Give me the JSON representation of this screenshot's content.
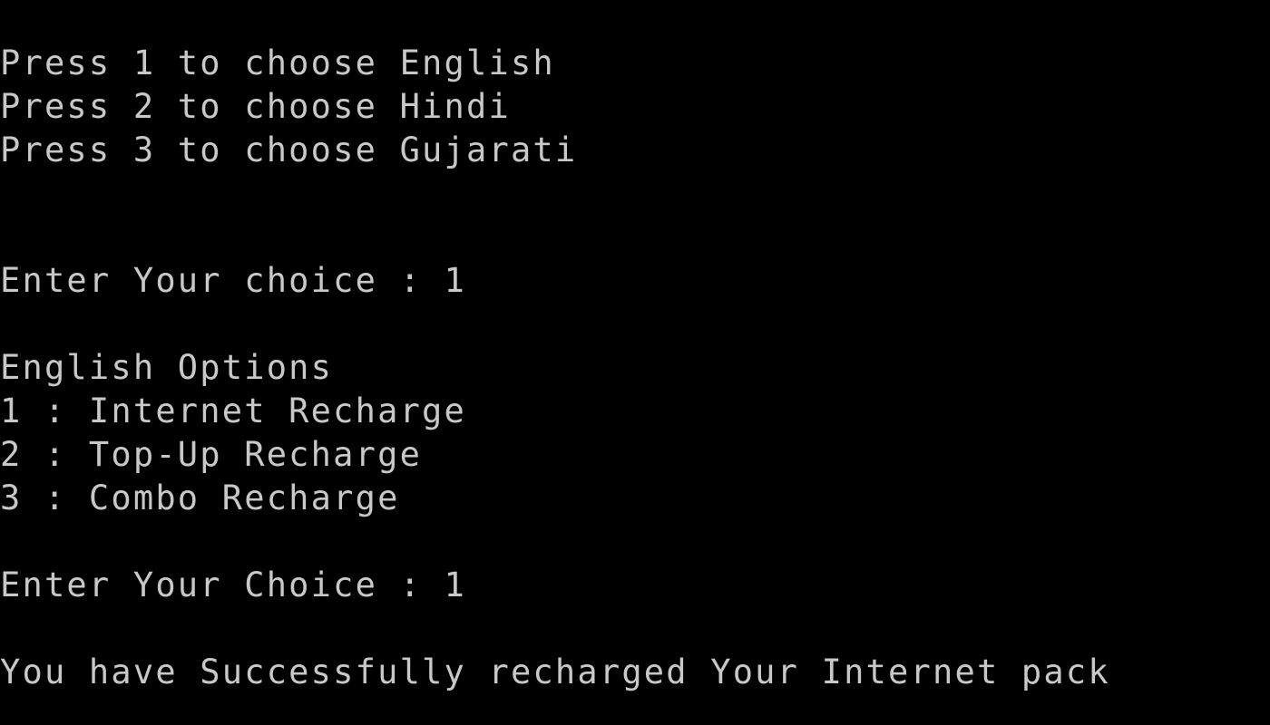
{
  "console": {
    "language_menu": [
      "Press 1 to choose English",
      "Press 2 to choose Hindi",
      "Press 3 to choose Gujarati"
    ],
    "language_prompt": "Enter Your choice : 1",
    "options_title": "English Options",
    "options": [
      "1 : Internet Recharge",
      "2 : Top-Up Recharge",
      "3 : Combo Recharge"
    ],
    "option_prompt": "Enter Your Choice : 1",
    "result_message": "You have Successfully recharged Your Internet pack"
  },
  "colors": {
    "background": "#000000",
    "text": "#c8c8c8"
  }
}
